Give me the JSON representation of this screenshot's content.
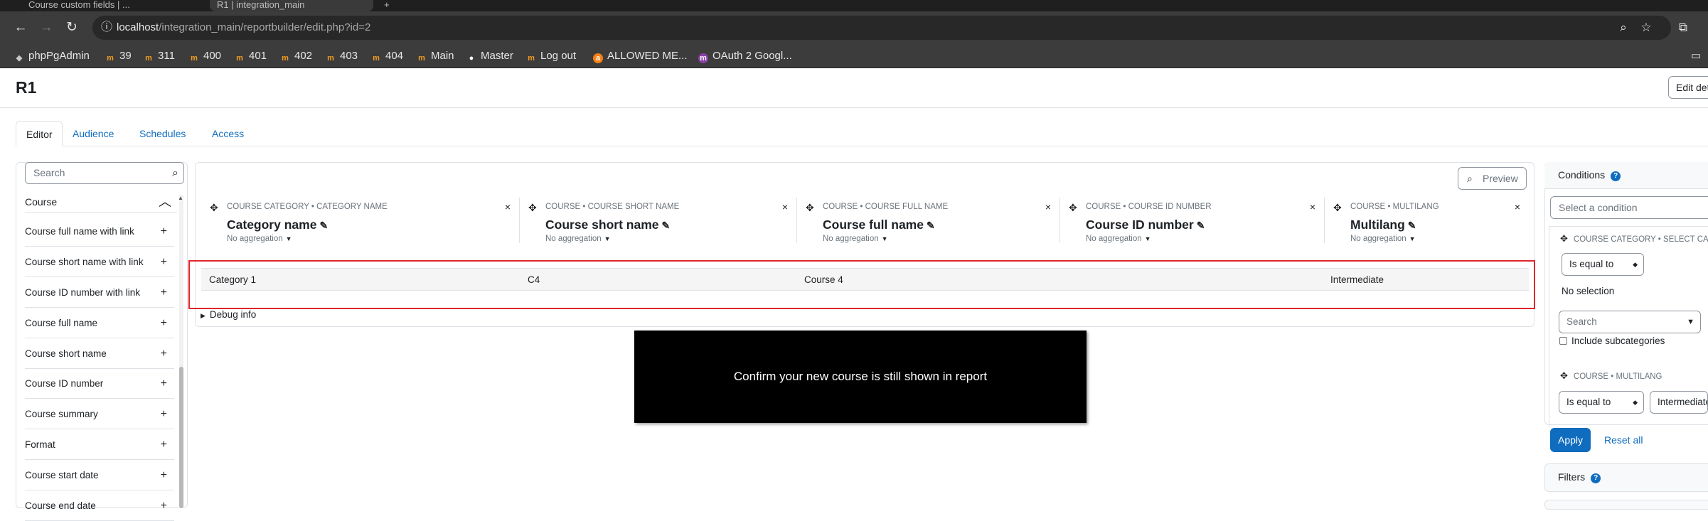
{
  "browser": {
    "tabs": [
      {
        "label": "Course custom fields | ..."
      },
      {
        "label": "R1 | integration_main"
      },
      {
        "label": "+"
      }
    ],
    "url_host": "localhost",
    "url_path": "/integration_main/reportbuilder/edit.php?id=2",
    "bookmarks": [
      {
        "label": "phpPgAdmin",
        "icon": "elephant-icon"
      },
      {
        "label": "39",
        "icon": "moodle-icon"
      },
      {
        "label": "311",
        "icon": "moodle-icon"
      },
      {
        "label": "400",
        "icon": "moodle-icon"
      },
      {
        "label": "401",
        "icon": "moodle-icon"
      },
      {
        "label": "402",
        "icon": "moodle-icon"
      },
      {
        "label": "403",
        "icon": "moodle-icon"
      },
      {
        "label": "404",
        "icon": "moodle-icon"
      },
      {
        "label": "Main",
        "icon": "moodle-icon"
      },
      {
        "label": "Master",
        "icon": "globe-icon"
      },
      {
        "label": "Log out",
        "icon": "moodle-icon"
      },
      {
        "label": "ALLOWED ME...",
        "icon": "orange-circle-icon"
      },
      {
        "label": "OAuth 2 Googl...",
        "icon": "purple-circle-icon"
      }
    ]
  },
  "page": {
    "title": "R1",
    "edit_details": "Edit det",
    "tabs": [
      "Editor",
      "Audience",
      "Schedules",
      "Access"
    ]
  },
  "sidebar": {
    "search_placeholder": "Search",
    "section": "Course",
    "items": [
      "Course full name with link",
      "Course short name with link",
      "Course ID number with link",
      "Course full name",
      "Course short name",
      "Course ID number",
      "Course summary",
      "Format",
      "Course start date",
      "Course end date"
    ]
  },
  "report": {
    "preview_label": "Preview",
    "columns": [
      {
        "crumb": "COURSE CATEGORY • CATEGORY NAME",
        "title": "Category name",
        "aggregation": "No aggregation"
      },
      {
        "crumb": "COURSE • COURSE SHORT NAME",
        "title": "Course short name",
        "aggregation": "No aggregation"
      },
      {
        "crumb": "COURSE • COURSE FULL NAME",
        "title": "Course full name",
        "aggregation": "No aggregation"
      },
      {
        "crumb": "COURSE • COURSE ID NUMBER",
        "title": "Course ID number",
        "aggregation": "No aggregation"
      },
      {
        "crumb": "COURSE • MULTILANG",
        "title": "Multilang",
        "aggregation": "No aggregation"
      }
    ],
    "rows": [
      [
        "Category 1",
        "C4",
        "Course 4",
        "",
        "Intermediate"
      ]
    ],
    "debug_label": "Debug info"
  },
  "notice": {
    "text": "Confirm your new course is still shown in report"
  },
  "conditions": {
    "title": "Conditions",
    "select_placeholder": "Select a condition",
    "condition1": {
      "crumb": "COURSE CATEGORY • SELECT CA",
      "operator": "Is equal to",
      "value": "No selection",
      "search_placeholder": "Search",
      "subcategories_label": "Include subcategories"
    },
    "condition2": {
      "crumb": "COURSE • MULTILANG",
      "operator": "Is equal to",
      "value": "Intermediate"
    },
    "apply_label": "Apply",
    "reset_label": "Reset all"
  },
  "filters": {
    "title": "Filters"
  },
  "colors": {
    "accent": "#0f6cbf",
    "highlight": "#e0262b",
    "notice_bg": "#000000"
  }
}
